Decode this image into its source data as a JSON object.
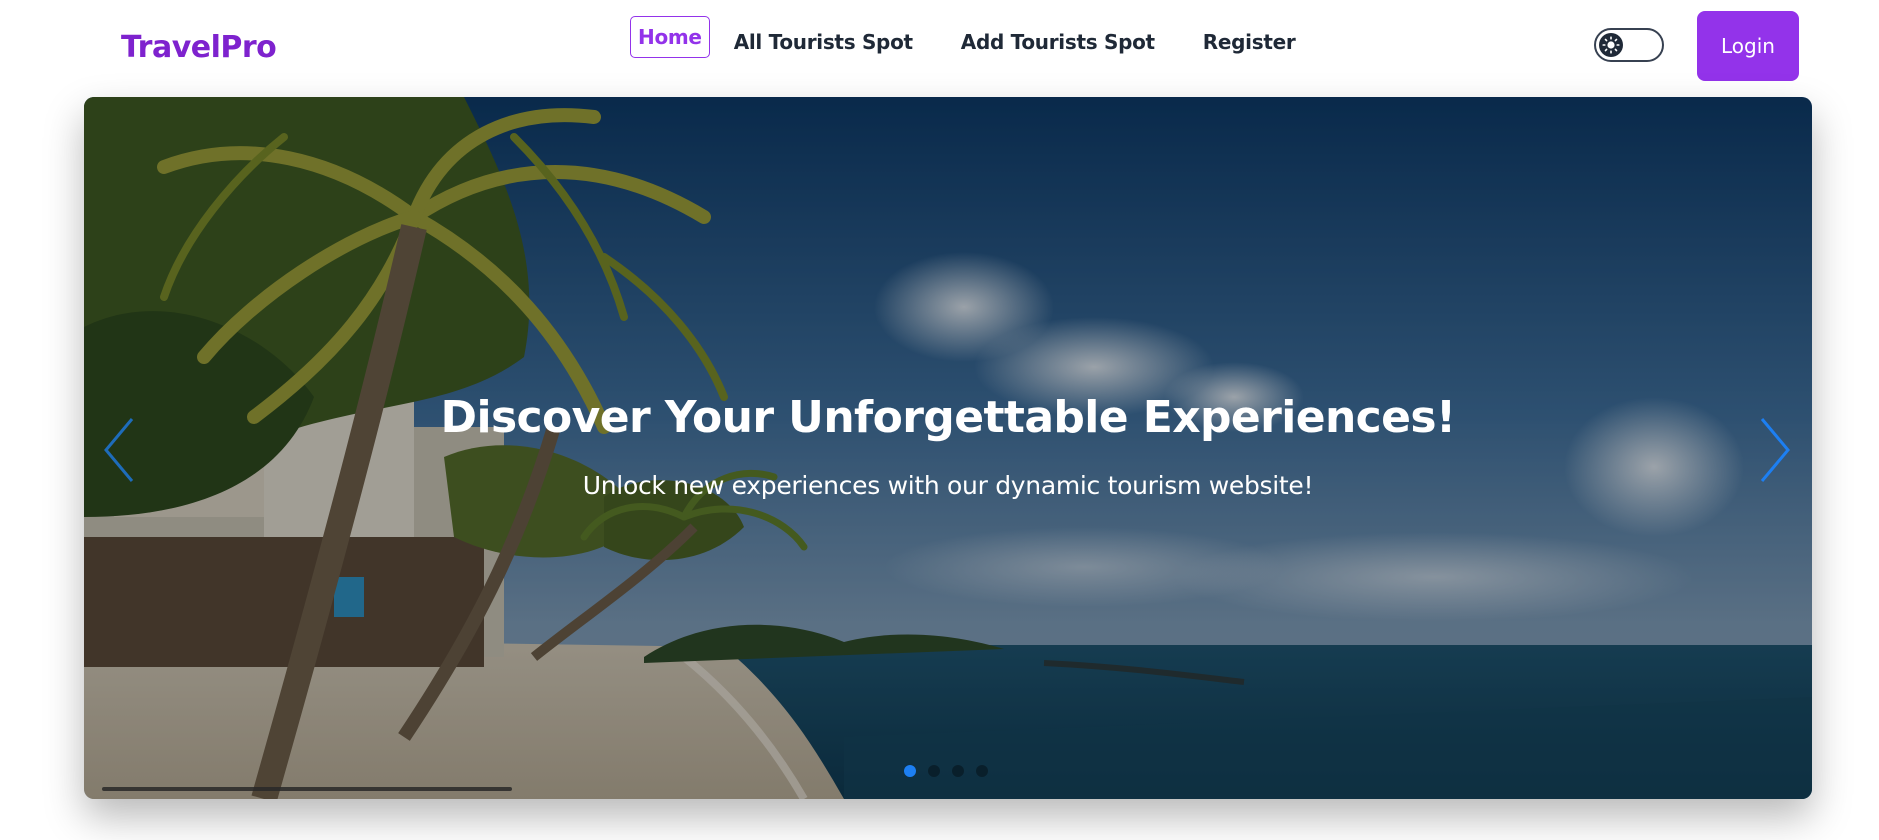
{
  "navbar": {
    "brand": "TravelPro",
    "links": [
      {
        "label": "Home",
        "active": true
      },
      {
        "label": "All Tourists Spot",
        "active": false
      },
      {
        "label": "Add Tourists Spot",
        "active": false
      },
      {
        "label": "Register",
        "active": false
      }
    ],
    "theme_toggle_icon": "sun-icon",
    "login_label": "Login"
  },
  "hero": {
    "title": "Discover Your Unforgettable Experiences!",
    "subtitle": "Unlock new experiences with our dynamic tourism website!",
    "prev_icon": "chevron-left-icon",
    "next_icon": "chevron-right-icon",
    "slide_count": 4,
    "active_slide": 1
  },
  "colors": {
    "brand": "#7e22ce",
    "accent": "#9333ea",
    "pagination_active": "#1d7ff2",
    "arrow": "#1d7ff2"
  }
}
